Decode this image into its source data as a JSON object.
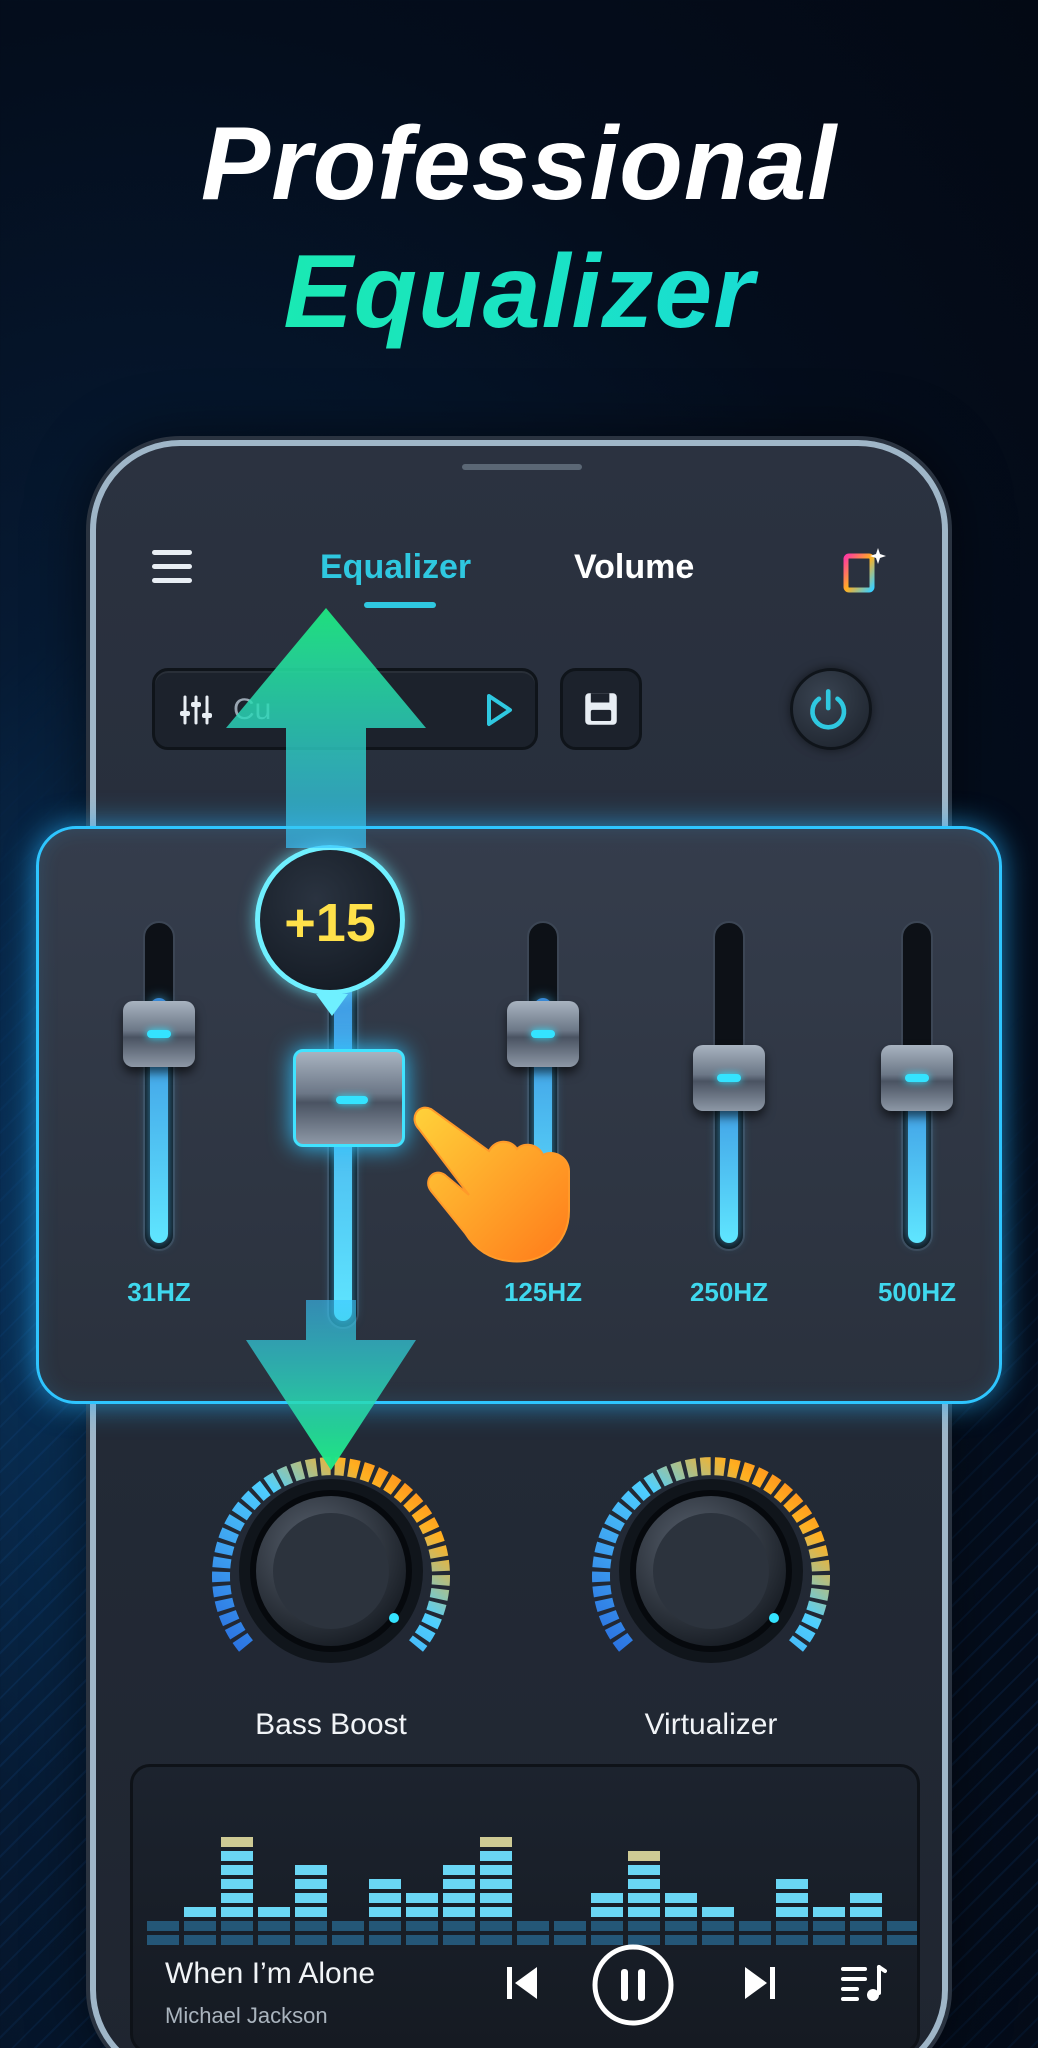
{
  "promo": {
    "headline_line1": "Professional",
    "headline_line2": "Equalizer"
  },
  "app": {
    "tabs": [
      {
        "label": "Equalizer",
        "active": true
      },
      {
        "label": "Volume",
        "active": false
      }
    ],
    "preset": {
      "label": "Cu"
    },
    "equalizer": {
      "popup_value": "+15",
      "bands": [
        {
          "label": "31HZ",
          "level": 0.78
        },
        {
          "label": "",
          "level": 1.0
        },
        {
          "label": "125HZ",
          "level": 0.78
        },
        {
          "label": "250HZ",
          "level": 0.55
        },
        {
          "label": "500HZ",
          "level": 0.55
        }
      ]
    },
    "effects": [
      {
        "label": "Bass Boost"
      },
      {
        "label": "Virtualizer"
      }
    ],
    "player": {
      "title": "When I’m Alone",
      "artist": "Michael Jackson"
    }
  },
  "colors": {
    "accent": "#2fc8e0",
    "arrow": "#19e07a",
    "popup_text": "#ffe14a"
  },
  "icons": [
    "menu-icon",
    "theme-icon",
    "equalizer-preset-icon",
    "play-icon",
    "save-icon",
    "power-icon",
    "previous-icon",
    "pause-icon",
    "next-icon",
    "playlist-icon",
    "hand-pointer-icon"
  ]
}
